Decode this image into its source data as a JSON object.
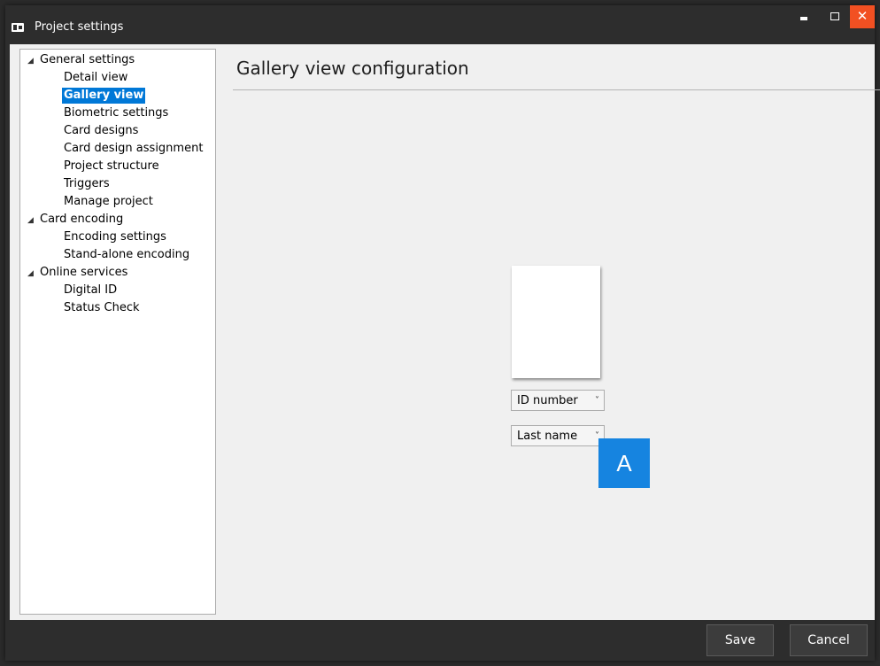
{
  "window": {
    "title": "Project settings",
    "icon": "id-card-icon",
    "close_color": "#f25022"
  },
  "tree": {
    "groups": [
      {
        "label": "General settings",
        "expanded": true,
        "children": [
          "Detail view",
          "Gallery view",
          "Biometric settings",
          "Card designs",
          "Card design assignment",
          "Project structure",
          "Triggers",
          "Manage project"
        ]
      },
      {
        "label": "Card encoding",
        "expanded": true,
        "children": [
          "Encoding settings",
          "Stand-alone encoding"
        ]
      },
      {
        "label": "Online services",
        "expanded": true,
        "children": [
          "Digital ID",
          "Status Check"
        ]
      }
    ],
    "selected": "Gallery view",
    "selection_color": "#0078d7"
  },
  "main": {
    "heading": "Gallery view configuration",
    "dropdowns": [
      {
        "value": "ID number"
      },
      {
        "value": "Last name"
      }
    ],
    "callout": {
      "label": "A",
      "color": "#1684e0"
    }
  },
  "footer": {
    "save_label": "Save",
    "cancel_label": "Cancel"
  }
}
